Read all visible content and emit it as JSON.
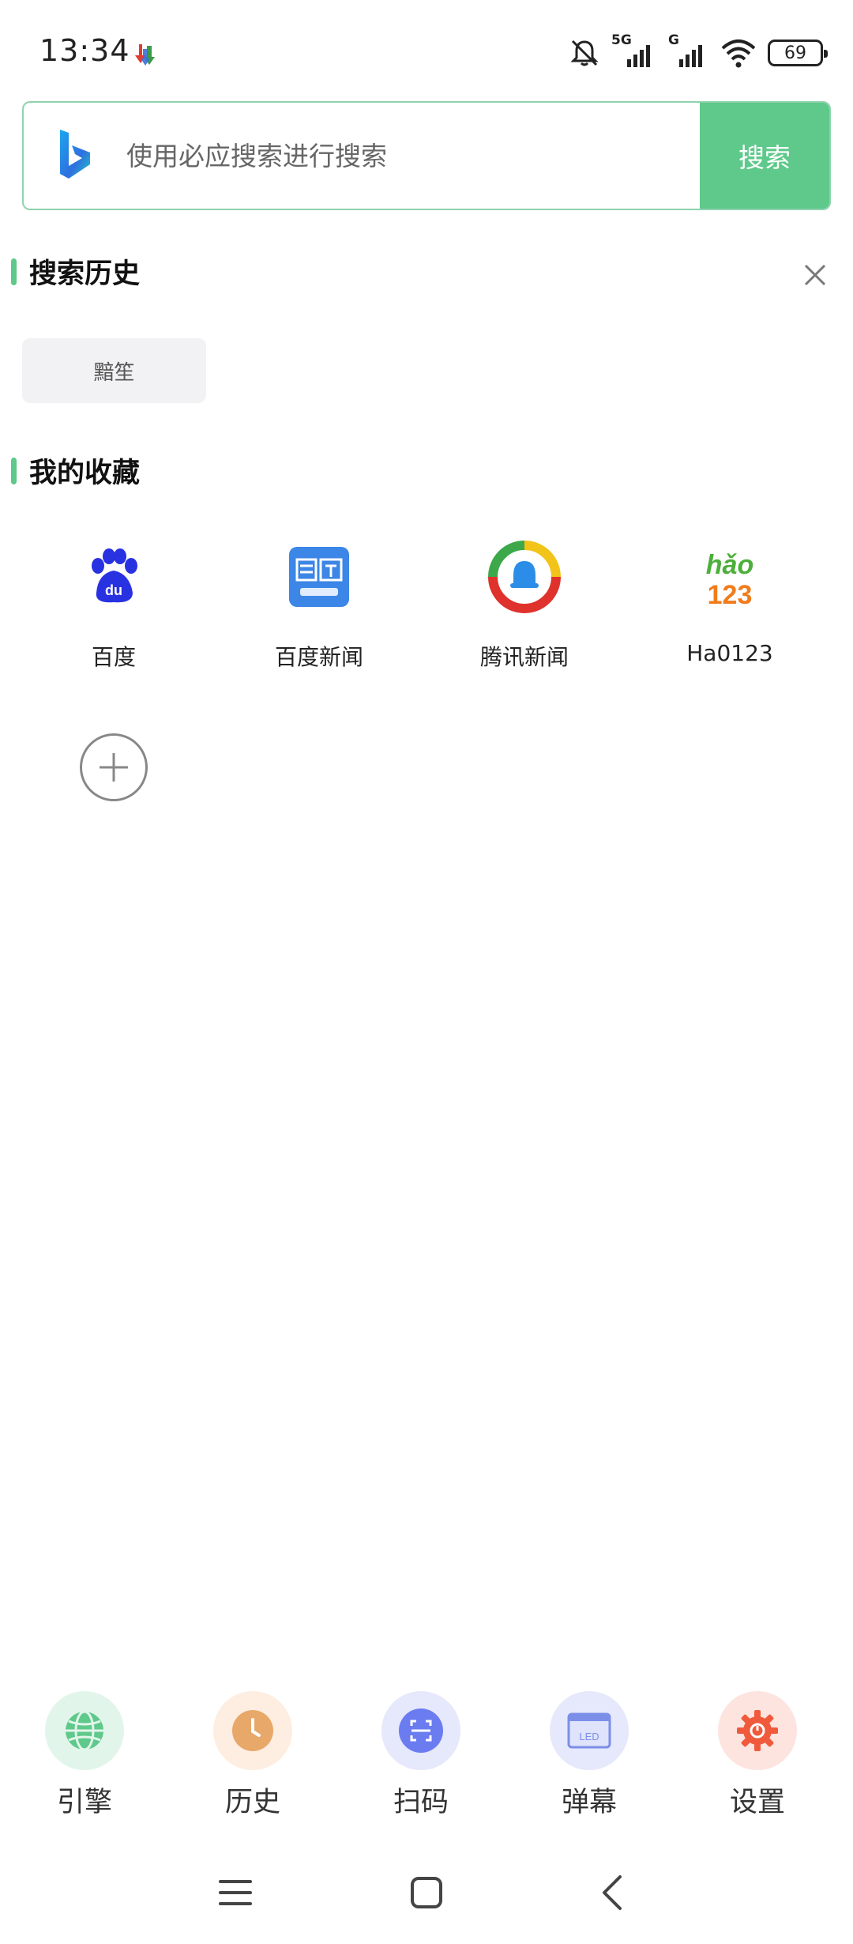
{
  "status_bar": {
    "time": "13:34",
    "network_5g": "5G",
    "network_g": "G",
    "battery": "69"
  },
  "search": {
    "placeholder": "使用必应搜索进行搜索",
    "button_label": "搜索",
    "engine_icon": "bing-logo"
  },
  "history": {
    "title": "搜索历史",
    "items": [
      "黯笙"
    ]
  },
  "favorites": {
    "title": "我的收藏",
    "items": [
      {
        "label": "百度",
        "icon": "baidu-logo"
      },
      {
        "label": "百度新闻",
        "icon": "baidu-news-logo"
      },
      {
        "label": "腾讯新闻",
        "icon": "tencent-news-logo"
      },
      {
        "label": "Ha0123",
        "icon": "hao123-logo"
      }
    ]
  },
  "toolbar": {
    "items": [
      {
        "label": "引擎",
        "icon": "globe-icon",
        "color": "#5ec98a",
        "bg": "#e2f5ea"
      },
      {
        "label": "历史",
        "icon": "clock-icon",
        "color": "#e8a86a",
        "bg": "#fdeee1"
      },
      {
        "label": "扫码",
        "icon": "scan-icon",
        "color": "#6a7cf0",
        "bg": "#e6e8fb"
      },
      {
        "label": "弹幕",
        "icon": "led-icon",
        "color": "#7b8fe8",
        "bg": "#e6e8fb"
      },
      {
        "label": "设置",
        "icon": "gear-icon",
        "color": "#f05a3c",
        "bg": "#fde4df"
      }
    ]
  },
  "colors": {
    "accent": "#5ec98a",
    "search_border": "#8fd3ae"
  }
}
